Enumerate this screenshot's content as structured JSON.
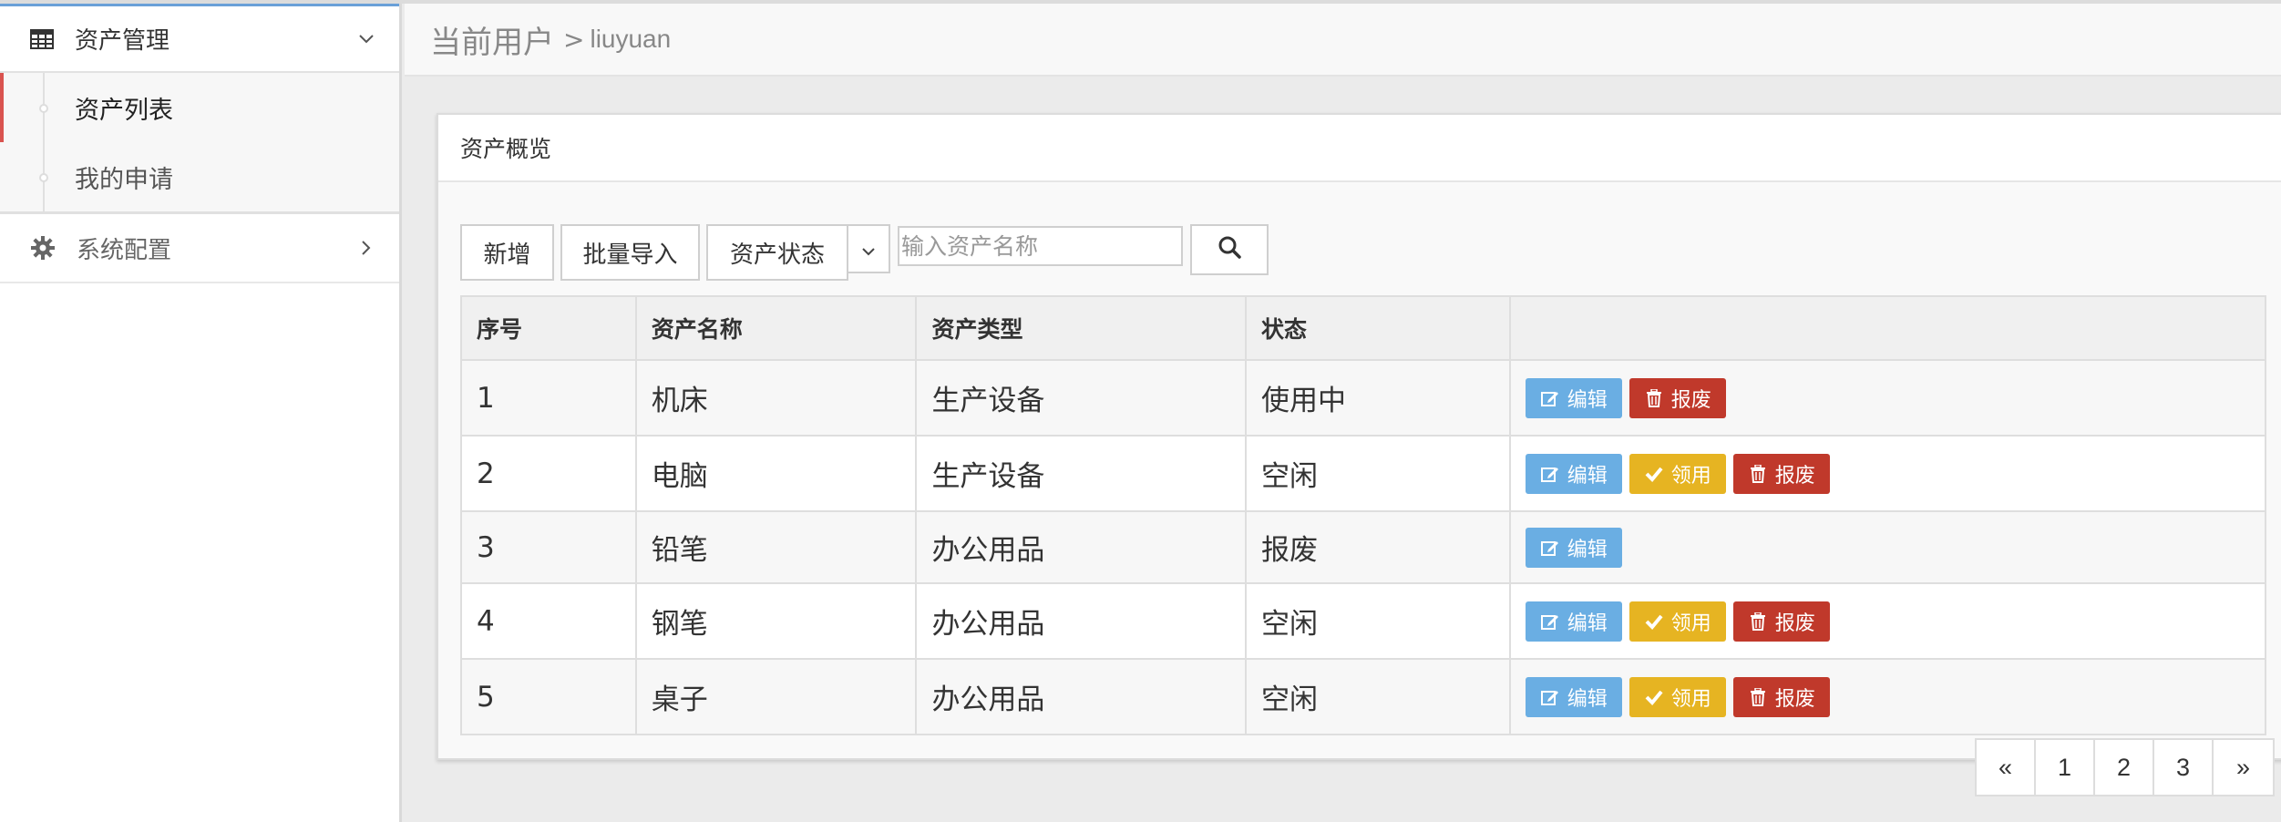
{
  "sidebar": {
    "asset_menu": {
      "label": "资产管理",
      "icon": "table-icon"
    },
    "sub_items": [
      {
        "label": "资产列表",
        "active": true
      },
      {
        "label": "我的申请",
        "active": false
      }
    ],
    "config_menu": {
      "label": "系统配置",
      "icon": "gear-icon"
    }
  },
  "header": {
    "title": "当前用户",
    "separator": ">",
    "user": "liuyuan"
  },
  "panel": {
    "title": "资产概览"
  },
  "toolbar": {
    "add_label": "新增",
    "import_label": "批量导入",
    "status_label": "资产状态",
    "search_placeholder": "输入资产名称"
  },
  "table": {
    "headers": [
      "序号",
      "资产名称",
      "资产类型",
      "状态",
      ""
    ],
    "rows": [
      {
        "id": "1",
        "name": "机床",
        "type": "生产设备",
        "status": "使用中",
        "actions": [
          "edit",
          "scrap"
        ]
      },
      {
        "id": "2",
        "name": "电脑",
        "type": "生产设备",
        "status": "空闲",
        "actions": [
          "edit",
          "claim",
          "scrap"
        ]
      },
      {
        "id": "3",
        "name": "铅笔",
        "type": "办公用品",
        "status": "报废",
        "actions": [
          "edit"
        ]
      },
      {
        "id": "4",
        "name": "钢笔",
        "type": "办公用品",
        "status": "空闲",
        "actions": [
          "edit",
          "claim",
          "scrap"
        ]
      },
      {
        "id": "5",
        "name": "桌子",
        "type": "办公用品",
        "status": "空闲",
        "actions": [
          "edit",
          "claim",
          "scrap"
        ]
      }
    ],
    "action_labels": {
      "edit": "编辑",
      "claim": "领用",
      "scrap": "报废"
    }
  },
  "pagination": {
    "prev": "«",
    "pages": [
      "1",
      "2",
      "3"
    ],
    "next": "»"
  },
  "colors": {
    "edit": "#6aaee3",
    "claim": "#e6b422",
    "scrap": "#c0392b",
    "active_marker": "#d9534f"
  }
}
